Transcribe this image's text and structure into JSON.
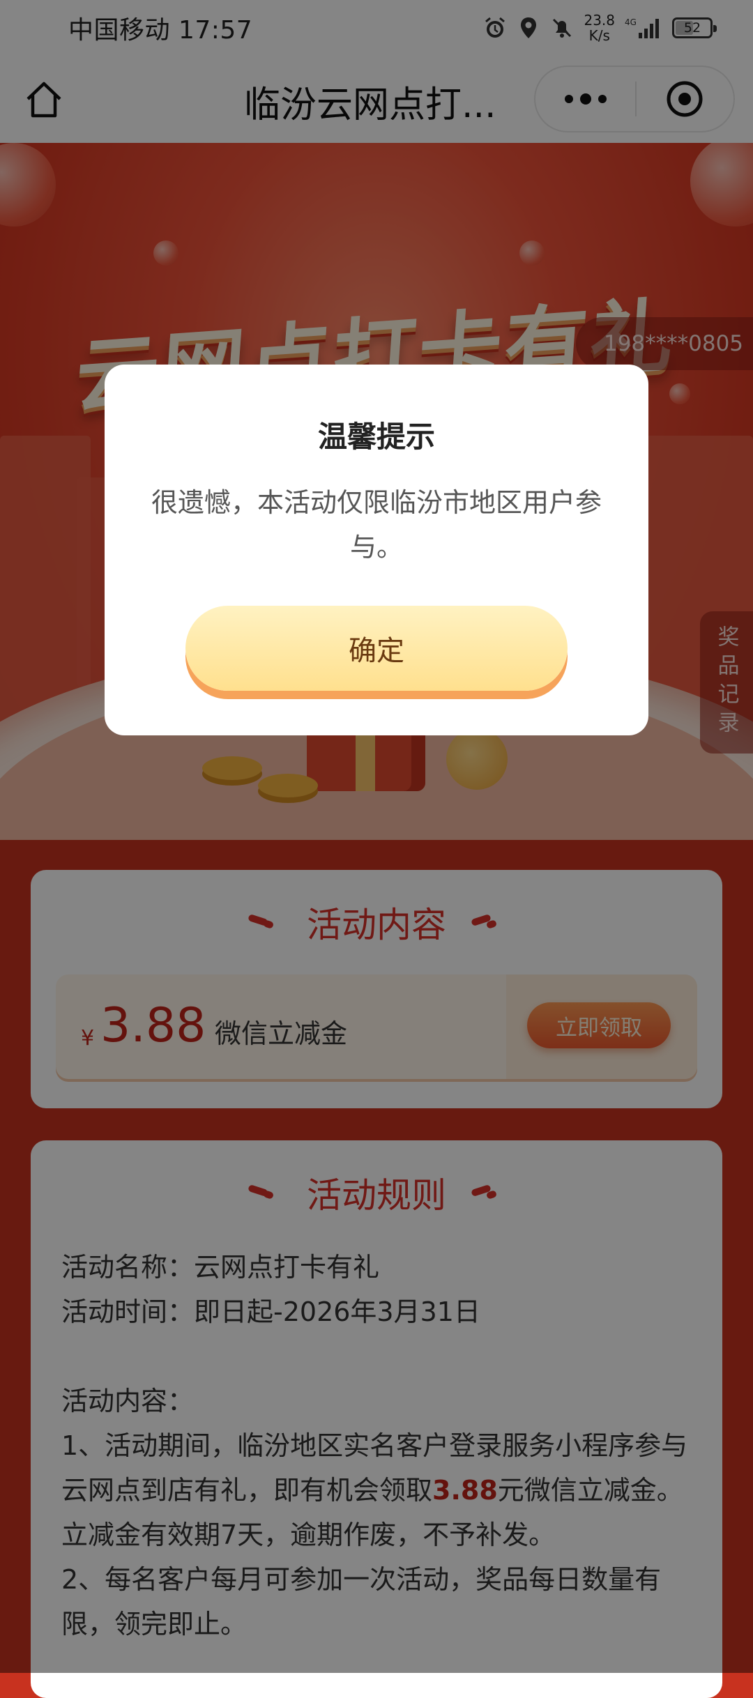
{
  "status_bar": {
    "carrier_time": "中国移动 17:57",
    "net_speed_value": "23.8",
    "net_speed_unit": "K/s",
    "network_type": "4G",
    "battery_level": "52",
    "battery_fraction": 0.52
  },
  "nav": {
    "title": "临汾云网点打..."
  },
  "hero": {
    "title": "云网点打卡有礼",
    "phone_masked": "198****0805",
    "prize_record_label": "奖品记录"
  },
  "activity": {
    "title": "活动内容",
    "coupon": {
      "currency": "¥",
      "amount": "3.88",
      "name": "微信立减金",
      "button": "立即领取"
    }
  },
  "rules": {
    "title": "活动规则",
    "name_line": "活动名称：云网点打卡有礼",
    "time_line": "活动时间：即日起-2026年3月31日",
    "content_heading": "活动内容：",
    "rule1_before": "1、活动期间，临汾地区实名客户登录服务小程序参与云网点到店有礼，即有机会领取",
    "rule1_highlight": "3.88",
    "rule1_after": "元微信立减金。立减金有效期7天，逾期作废，不予补发。",
    "rule2": "2、每名客户每月可参加一次活动，奖品每日数量有限，领完即止。"
  },
  "dialog": {
    "title": "温馨提示",
    "message": "很遗憾，本活动仅限临汾市地区用户参与。",
    "confirm": "确定"
  }
}
